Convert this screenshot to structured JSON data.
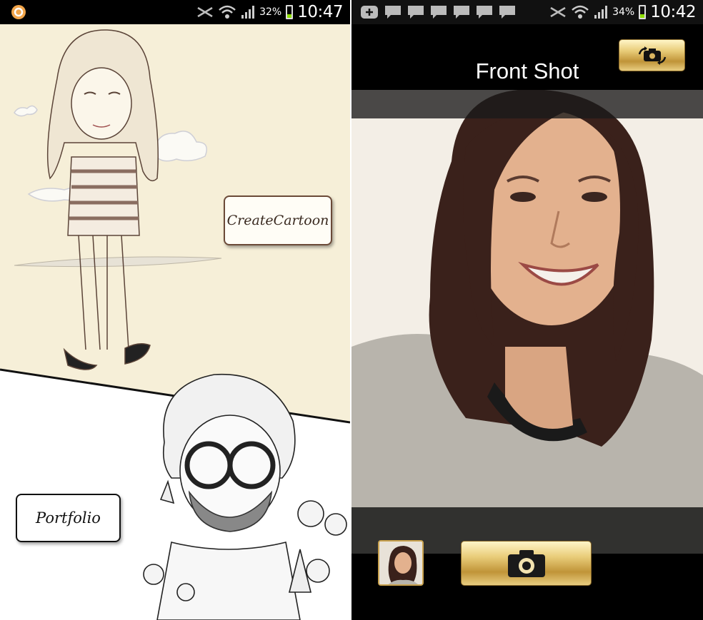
{
  "left_app": {
    "status_bar": {
      "battery": "32%",
      "time": "10:47"
    },
    "buttons": {
      "create_cartoon": "CreateCartoon",
      "portfolio": "Portfolio"
    },
    "icons": [
      "app-notification-icon",
      "mute-icon",
      "wifi-icon",
      "signal-icon",
      "battery-icon"
    ]
  },
  "right_app": {
    "status_bar": {
      "battery": "34%",
      "time": "10:42"
    },
    "title": "Front Shot",
    "icons": [
      "switch-camera-icon",
      "camera-icon",
      "message-icon",
      "add-icon"
    ]
  },
  "colors": {
    "sketch_bg": "#f6efd8",
    "gold": "#d9b560",
    "black": "#000000"
  }
}
